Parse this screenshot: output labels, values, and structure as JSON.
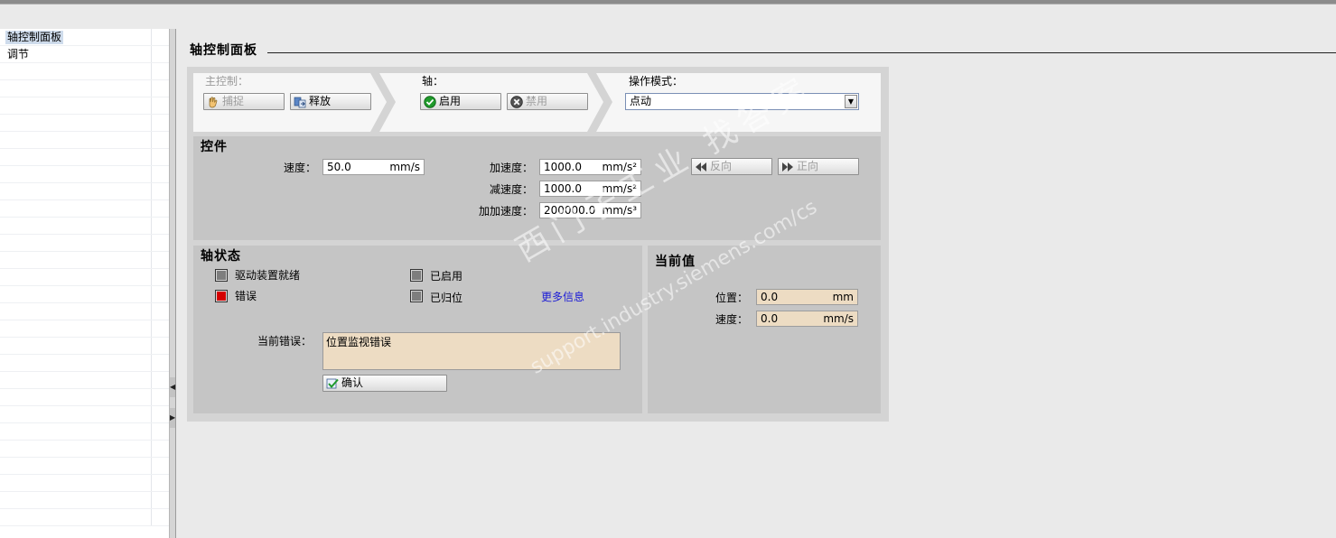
{
  "nav": {
    "items": [
      {
        "label": "轴控制面板",
        "selected": true
      },
      {
        "label": "调节",
        "selected": false
      }
    ]
  },
  "page": {
    "title": "轴控制面板"
  },
  "master_control": {
    "label": "主控制：",
    "capture_label": "捕捉",
    "release_label": "释放"
  },
  "axis": {
    "label": "轴：",
    "enable_label": "启用",
    "disable_label": "禁用"
  },
  "operation_mode": {
    "label": "操作模式：",
    "selected": "点动"
  },
  "controls": {
    "title": "控件",
    "velocity": {
      "label": "速度：",
      "value": "50.0",
      "unit": "mm/s"
    },
    "acceleration": {
      "label": "加速度：",
      "value": "1000.0",
      "unit": "mm/s²"
    },
    "deceleration": {
      "label": "减速度：",
      "value": "1000.0",
      "unit": "mm/s²"
    },
    "jerk": {
      "label": "加加速度：",
      "value": "200000.0",
      "unit": "mm/s³"
    },
    "backward_label": "反向",
    "forward_label": "正向"
  },
  "axis_status": {
    "title": "轴状态",
    "drive_ready_label": "驱动装置就绪",
    "error_label": "错误",
    "enabled_label": "已启用",
    "homed_label": "已归位",
    "more_info_label": "更多信息",
    "current_error_label": "当前错误：",
    "current_error_text": "位置监视错误",
    "acknowledge_label": "确认"
  },
  "current_values": {
    "title": "当前值",
    "position": {
      "label": "位置：",
      "value": "0.0",
      "unit": "mm"
    },
    "velocity": {
      "label": "速度：",
      "value": "0.0",
      "unit": "mm/s"
    }
  },
  "watermark": {
    "line1": "西门子工业 找答案",
    "line2": "support.industry.siemens.com/cs"
  },
  "colors": {
    "error_red": "#d40000",
    "readonly_bg": "#eddcc3",
    "link_blue": "#1a1ad6",
    "selection_bg": "#cfdcec"
  }
}
